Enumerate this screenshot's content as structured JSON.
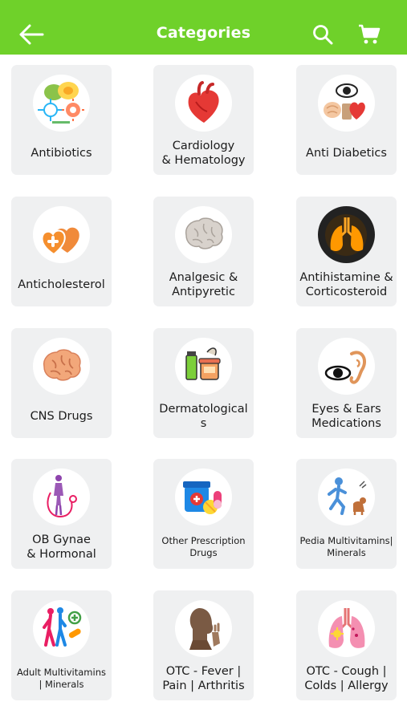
{
  "header": {
    "title": "Categories",
    "background": "#6fd12a",
    "icons": [
      "back-arrow-icon",
      "search-icon",
      "cart-icon"
    ]
  },
  "categories": [
    {
      "label": "Antibiotics",
      "icon": "antibiotics-icon"
    },
    {
      "label": "Cardiology\n& Hematology",
      "icon": "heart-icon"
    },
    {
      "label": "Anti Diabetics",
      "icon": "eye-brain-heart-icon"
    },
    {
      "label": "Anticholesterol",
      "icon": "heart-plus-icon"
    },
    {
      "label": "Analgesic &\nAntipyretic",
      "icon": "brain-gray-icon"
    },
    {
      "label": "Antihistamine &\nCorticosteroid",
      "icon": "lungs-icon"
    },
    {
      "label": "CNS Drugs",
      "icon": "brain-icon"
    },
    {
      "label": "Dermatological\ns",
      "icon": "skincare-icon"
    },
    {
      "label": "Eyes & Ears\nMedications",
      "icon": "eye-ear-icon"
    },
    {
      "label": "OB Gynae\n& Hormonal",
      "icon": "woman-stethoscope-icon"
    },
    {
      "label": "Other Prescription\nDrugs",
      "icon": "pill-bottle-icon"
    },
    {
      "label": "Pedia Multivitamins|\nMinerals",
      "icon": "child-running-icon"
    },
    {
      "label": "Adult Multivitamins\n| Minerals",
      "icon": "adults-walking-icon"
    },
    {
      "label": "OTC - Fever |\nPain | Arthritis",
      "icon": "head-pain-icon"
    },
    {
      "label": "OTC - Cough |\nColds | Allergy",
      "icon": "lungs-pink-icon"
    }
  ]
}
